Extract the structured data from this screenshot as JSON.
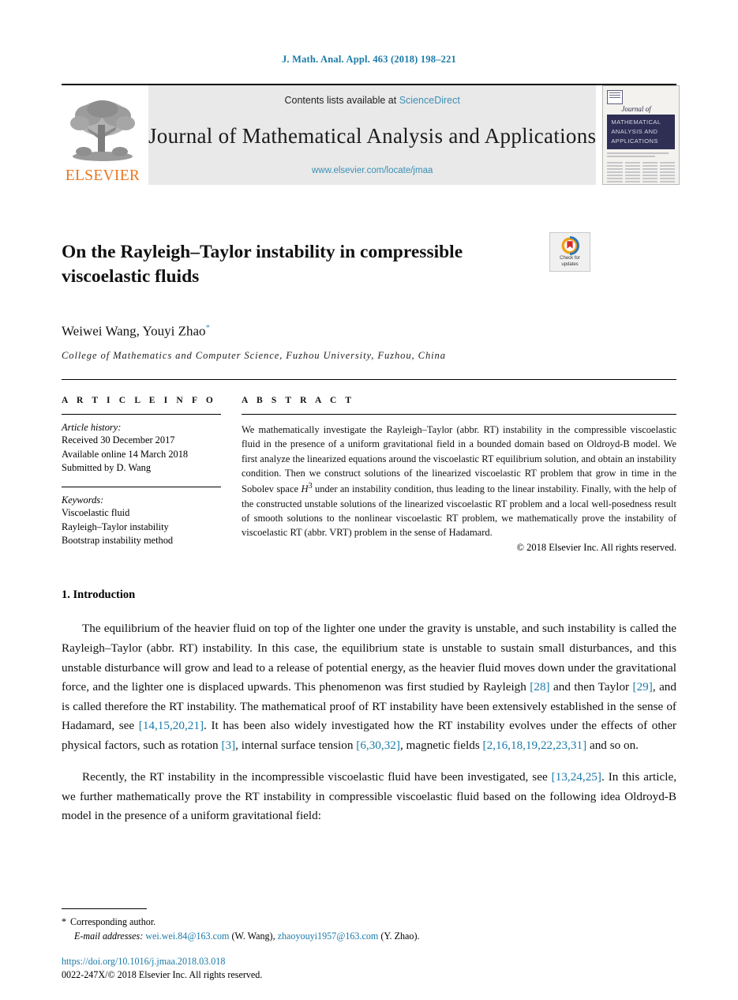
{
  "running_head": "J. Math. Anal. Appl. 463 (2018) 198–221",
  "masthead": {
    "publisher_name": "ELSEVIER",
    "contents_prefix": "Contents lists available at",
    "contents_link": "ScienceDirect",
    "journal_title": "Journal of Mathematical Analysis and Applications",
    "journal_url": "www.elsevier.com/locate/jmaa",
    "cover": {
      "journal_of": "Journal of",
      "band_line1": "MATHEMATICAL",
      "band_line2": "ANALYSIS AND",
      "band_line3": "APPLICATIONS"
    }
  },
  "article": {
    "title": "On the Rayleigh–Taylor instability in compressible viscoelastic fluids",
    "authors": "Weiwei Wang, Youyi Zhao",
    "corresponding_marker": "*",
    "affiliation": "College of Mathematics and Computer Science, Fuzhou University, Fuzhou, China",
    "crossmark": {
      "line1": "Check for",
      "line2": "updates"
    }
  },
  "article_info": {
    "heading": "A R T I C L E   I N F O",
    "history_title": "Article history:",
    "history": [
      "Received 30 December 2017",
      "Available online 14 March 2018",
      "Submitted by D. Wang"
    ],
    "keywords_title": "Keywords:",
    "keywords": [
      "Viscoelastic fluid",
      "Rayleigh–Taylor instability",
      "Bootstrap instability method"
    ]
  },
  "abstract": {
    "heading": "A B S T R A C T",
    "text_before_math": "We mathematically investigate the Rayleigh–Taylor (abbr. RT) instability in the compressible viscoelastic fluid in the presence of a uniform gravitational field in a bounded domain based on Oldroyd-B model. We first analyze the linearized equations around the viscoelastic RT equilibrium solution, and obtain an instability condition. Then we construct solutions of the linearized viscoelastic RT problem that grow in time in the Sobolev space ",
    "math_symbol": "H",
    "math_superscript": "3",
    "text_after_math": " under an instability condition, thus leading to the linear instability. Finally, with the help of the constructed unstable solutions of the linearized viscoelastic RT problem and a local well-posedness result of smooth solutions to the nonlinear viscoelastic RT problem, we mathematically prove the instability of viscoelastic RT (abbr. VRT) problem in the sense of Hadamard.",
    "copyright": "© 2018 Elsevier Inc. All rights reserved."
  },
  "body": {
    "section_number_title": "1. Introduction",
    "paragraph1": [
      {
        "t": "The equilibrium of the heavier fluid on top of the lighter one under the gravity is unstable, and such instability is called the Rayleigh–Taylor (abbr. RT) instability. In this case, the equilibrium state is unstable to sustain small disturbances, and this unstable disturbance will grow and lead to a release of potential energy, as the heavier fluid moves down under the gravitational force, and the lighter one is displaced upwards. This phenomenon was first studied by Rayleigh "
      },
      {
        "t": "[28]",
        "cite": true
      },
      {
        "t": " and then Taylor "
      },
      {
        "t": "[29]",
        "cite": true
      },
      {
        "t": ", and is called therefore the RT instability. The mathematical proof of RT instability have been extensively established in the sense of Hadamard, see "
      },
      {
        "t": "[14,15,20,21]",
        "cite": true
      },
      {
        "t": ". It has been also widely investigated how the RT instability evolves under the effects of other physical factors, such as rotation "
      },
      {
        "t": "[3]",
        "cite": true
      },
      {
        "t": ", internal surface tension "
      },
      {
        "t": "[6,30,32]",
        "cite": true
      },
      {
        "t": ", magnetic fields "
      },
      {
        "t": "[2,16,18,19,22,23,31]",
        "cite": true
      },
      {
        "t": " and so on."
      }
    ],
    "paragraph2": [
      {
        "t": "Recently, the RT instability in the incompressible viscoelastic fluid have been investigated, see "
      },
      {
        "t": "[13,24,25]",
        "cite": true
      },
      {
        "t": ". In this article, we further mathematically prove the RT instability in compressible viscoelastic fluid based on the following idea Oldroyd-B model in the presence of a uniform gravitational field:"
      }
    ]
  },
  "footnote": {
    "star": "*",
    "corresponding": "Corresponding author.",
    "email_label": "E-mail addresses:",
    "email1": "wei.wei.84@163.com",
    "email1_owner": "(W. Wang),",
    "email2": "zhaoyouyi1957@163.com",
    "email2_owner": "(Y. Zhao)."
  },
  "doi": {
    "url": "https://doi.org/10.1016/j.jmaa.2018.03.018",
    "issn_line": "0022-247X/© 2018 Elsevier Inc. All rights reserved."
  },
  "colors": {
    "link_blue": "#1a7aa8",
    "sciencedirect_blue": "#3c8fb5",
    "elsevier_orange": "#E87722",
    "cover_navy": "#2f2f55"
  }
}
